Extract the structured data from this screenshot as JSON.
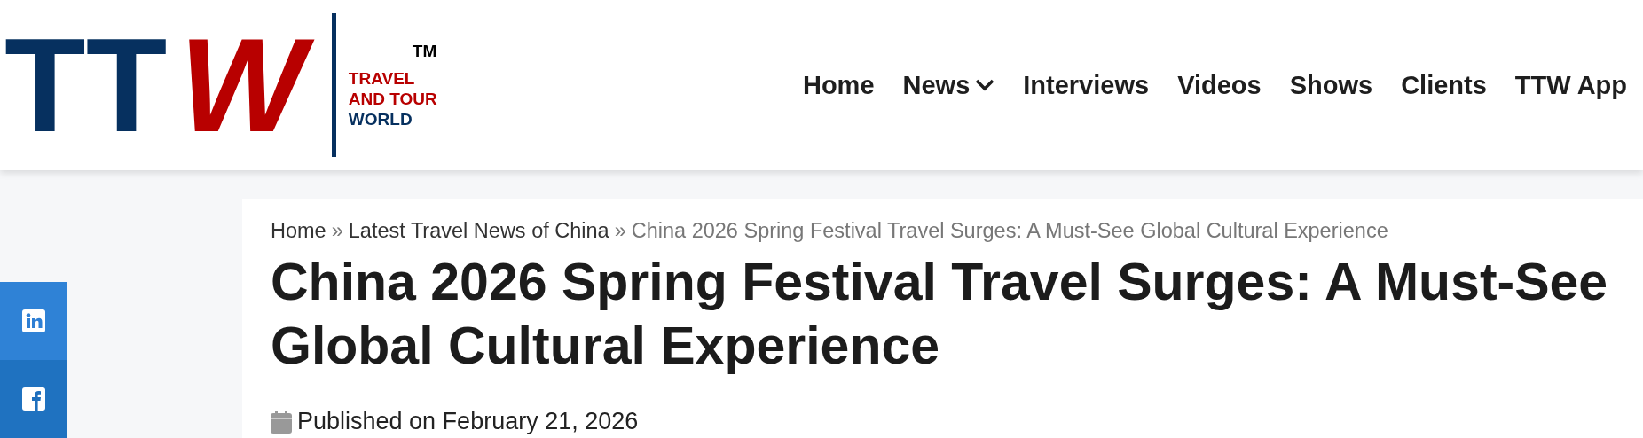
{
  "logo": {
    "mark_left": "TT",
    "mark_right": "W",
    "trademark": "TM",
    "tagline_top": "TRAVEL",
    "tagline_middle": "AND TOUR",
    "tagline_bottom": "WORLD"
  },
  "nav": [
    {
      "label": "Home",
      "dropdown": false
    },
    {
      "label": "News",
      "dropdown": true
    },
    {
      "label": "Interviews",
      "dropdown": false
    },
    {
      "label": "Videos",
      "dropdown": false
    },
    {
      "label": "Shows",
      "dropdown": false
    },
    {
      "label": "Clients",
      "dropdown": false
    },
    {
      "label": "TTW App",
      "dropdown": false
    }
  ],
  "social": [
    {
      "kind": "linkedin"
    },
    {
      "kind": "facebook"
    }
  ],
  "breadcrumb": [
    {
      "label": "Home",
      "current": false
    },
    {
      "label": "Latest Travel News of China",
      "current": false
    },
    {
      "label": "China 2026 Spring Festival Travel Surges: A Must-See Global Cultural Experience",
      "current": true
    }
  ],
  "breadcrumb_separator": "»",
  "article": {
    "title": "China 2026 Spring Festival Travel Surges: A Must-See Global Cultural Experience",
    "published": "Published on February 21, 2026"
  }
}
